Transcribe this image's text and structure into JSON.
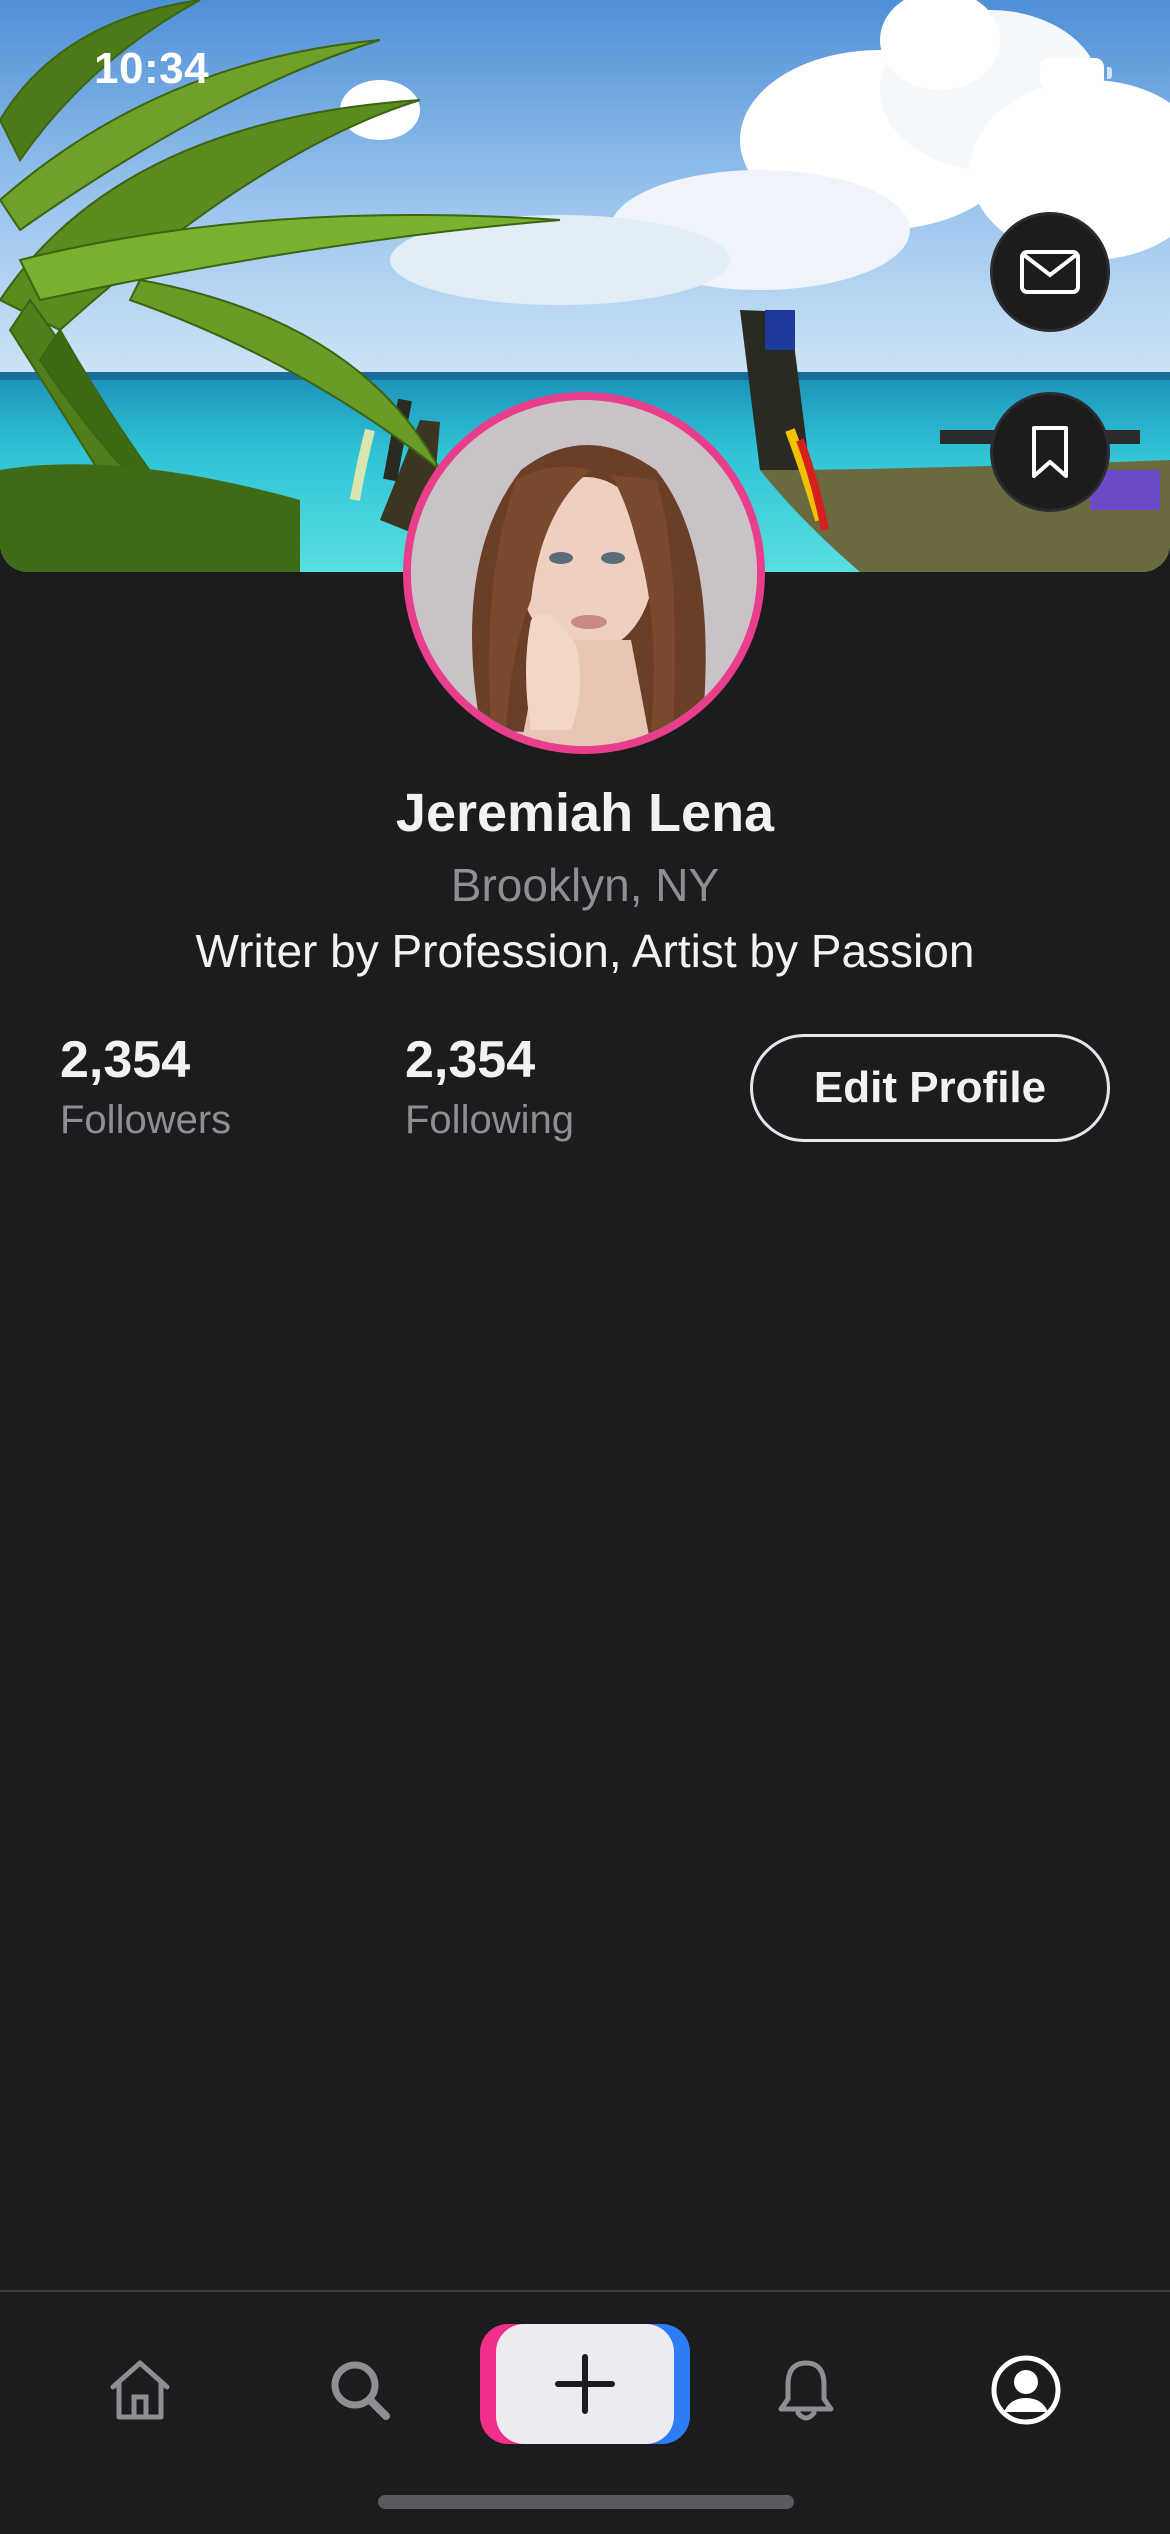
{
  "status_bar": {
    "time": "10:34"
  },
  "profile": {
    "name": "Jeremiah Lena",
    "location": "Brooklyn, NY",
    "bio": "Writer by Profession, Artist by Passion"
  },
  "stats": {
    "followers": {
      "count": "2,354",
      "label": "Followers"
    },
    "following": {
      "count": "2,354",
      "label": "Following"
    }
  },
  "actions": {
    "edit_profile": "Edit Profile"
  },
  "tab_bar": {
    "items": [
      "home-icon",
      "search-icon",
      "add-icon",
      "bell-icon",
      "profile-icon"
    ],
    "selected": "profile-icon"
  },
  "colors": {
    "background": "#1c1c1e",
    "avatar_ring": "#e83e8c",
    "add_button_pink": "#f0308a",
    "add_button_blue": "#2e7cf6",
    "secondary_text": "#8e8e93"
  }
}
